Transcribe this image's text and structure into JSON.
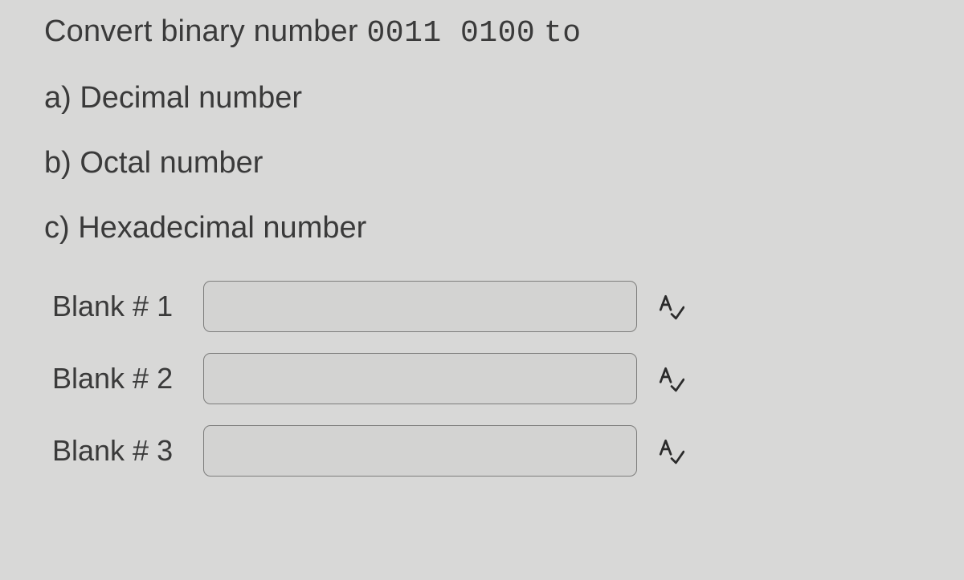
{
  "question": {
    "prefix": "Convert binary number",
    "binary_value": "0011 0100",
    "suffix": "to"
  },
  "parts": {
    "a": "a) Decimal number",
    "b": "b) Octal number",
    "c": "c) Hexadecimal number"
  },
  "blanks": [
    {
      "label": "Blank # 1",
      "value": ""
    },
    {
      "label": "Blank # 2",
      "value": ""
    },
    {
      "label": "Blank # 3",
      "value": ""
    }
  ]
}
